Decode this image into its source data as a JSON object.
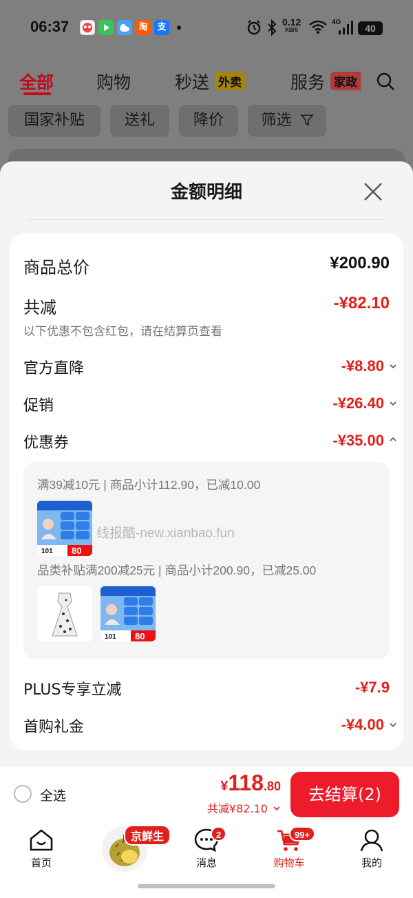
{
  "status_bar": {
    "time": "06:37",
    "app_icons": [
      "game-icon",
      "video-icon",
      "weather-icon",
      "taobao-icon",
      "alipay-icon"
    ],
    "taobao_glyph": "淘",
    "alipay_glyph": "支",
    "net_speed_value": "0.12",
    "net_speed_unit": "KB/S",
    "network": "4G",
    "battery": "40"
  },
  "top_tabs": {
    "items": [
      "全部",
      "购物",
      "秒送",
      "服务"
    ],
    "badges": [
      "外卖",
      "家政"
    ],
    "active": "全部"
  },
  "chips": [
    "国家补贴",
    "送礼",
    "降价",
    "筛选"
  ],
  "sheet": {
    "title": "金额明细",
    "total_label": "商品总价",
    "total_value": "¥200.90",
    "reduce_label": "共减",
    "reduce_value": "-¥82.10",
    "reduce_note": "以下优惠不包含红包，请在结算页查看",
    "rows": [
      {
        "label": "官方直降",
        "value": "-¥8.80"
      },
      {
        "label": "促销",
        "value": "-¥26.40"
      },
      {
        "label": "优惠券",
        "value": "-¥35.00"
      },
      {
        "label": "PLUS专享立减",
        "value": "-¥7.9"
      },
      {
        "label": "首购礼金",
        "value": "-¥4.00"
      }
    ],
    "coupon_lines": [
      "满39减10元 | 商品小计112.90，已减10.00",
      "品类补贴满200减25元 | 商品小计200.90，已减25.00"
    ],
    "watermark": "线报酷-new.xianbao.fun",
    "product_label_a": "101",
    "product_label_b": "80"
  },
  "bottom_bar": {
    "select_all": "全选",
    "currency": "¥",
    "total_int": "118",
    "total_dec": ".80",
    "saved": "共减¥82.10",
    "checkout": "去结算(2)"
  },
  "bottom_nav": {
    "items": [
      "首页",
      "",
      "消息",
      "购物车",
      "我的"
    ],
    "fresh_badge": "京鲜生",
    "message_badge": "2",
    "cart_badge": "99+",
    "active": "购物车"
  },
  "colors": {
    "accent_red": "#e0201a",
    "checkout_red": "#ee1b2a",
    "tab_red": "#c40a1a"
  }
}
